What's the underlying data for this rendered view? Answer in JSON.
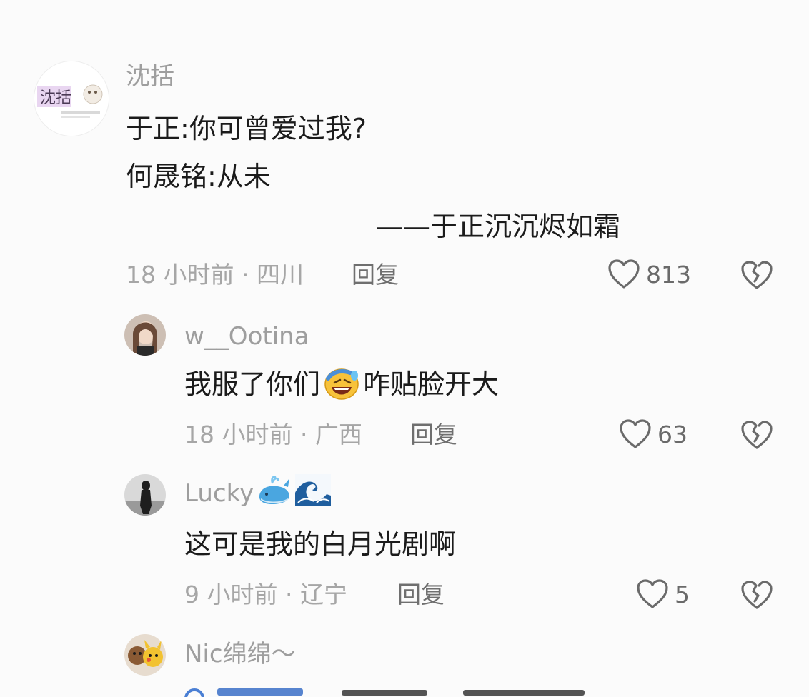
{
  "comments": [
    {
      "username": "沈括",
      "avatar_text": "沈括",
      "lines": [
        "于正:你可曾爱过我?",
        "何晟铭:从未",
        "——于正沉沉烬如霜"
      ],
      "time_location": "18 小时前 · 四川",
      "reply_label": "回复",
      "likes": "813"
    },
    {
      "username": "w__Ootina",
      "text_before_emoji": "我服了你们",
      "emoji": "rofl-emoji",
      "text_after_emoji": "咋贴脸开大",
      "time_location": "18 小时前 · 广西",
      "reply_label": "回复",
      "likes": "63"
    },
    {
      "username": "Lucky",
      "username_emojis": [
        "whale-emoji",
        "wave-emoji"
      ],
      "text": "这可是我的白月光剧啊",
      "time_location": "9 小时前 · 辽宁",
      "reply_label": "回复",
      "likes": "5"
    },
    {
      "username": "Nic绵绵～"
    }
  ],
  "colors": {
    "background": "#fbfbfb",
    "text": "#1b1b1b",
    "username": "#9e9e9e",
    "meta": "#a6a6a6",
    "reply": "#6f6f6f",
    "icon": "#6a6a6a"
  },
  "icons": {
    "like": "heart-outline-icon",
    "dislike": "broken-heart-icon"
  }
}
